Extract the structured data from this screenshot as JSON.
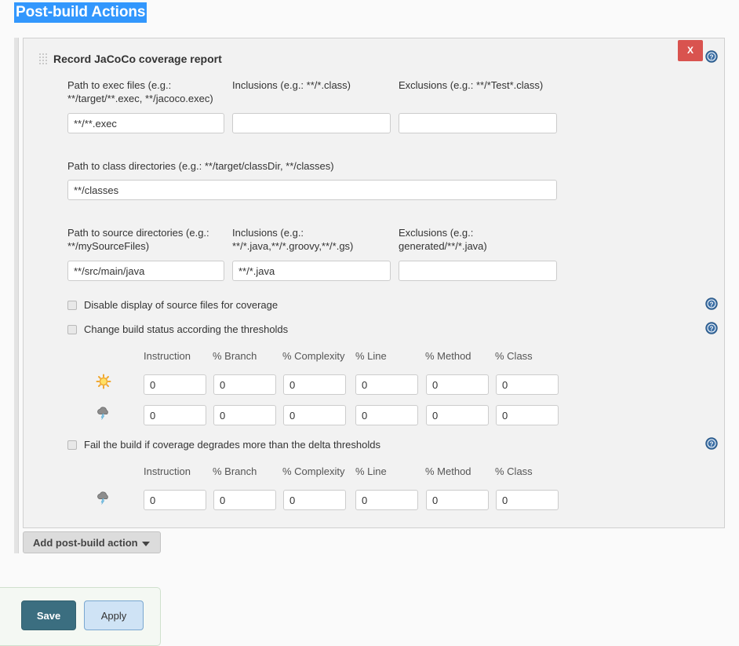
{
  "page": {
    "title": "Post-build Actions",
    "title_highlight_color": "#3297fd"
  },
  "panel": {
    "heading": "Record JaCoCo coverage report",
    "grip_icon": "drag-grip-icon",
    "delete_label": "X",
    "delete_color": "#d9534f",
    "help_icon": "help-icon"
  },
  "exec_section": {
    "path_label": "Path to exec files (e.g.: **/target/**.exec, **/jacoco.exec)",
    "path_value": "**/**.exec",
    "inclusions_label": "Inclusions (e.g.: **/*.class)",
    "inclusions_value": "",
    "exclusions_label": "Exclusions (e.g.: **/*Test*.class)",
    "exclusions_value": ""
  },
  "class_section": {
    "label": "Path to class directories (e.g.: **/target/classDir, **/classes)",
    "value": "**/classes"
  },
  "source_section": {
    "path_label": "Path to source directories (e.g.: **/mySourceFiles)",
    "path_value": "**/src/main/java",
    "inclusions_label": "Inclusions (e.g.: **/*.java,**/*.groovy,**/*.gs)",
    "inclusions_value": "**/*.java",
    "exclusions_label": "Exclusions (e.g.: generated/**/*.java)",
    "exclusions_value": ""
  },
  "options": {
    "disable_source_display": {
      "label": "Disable display of source files for coverage",
      "checked": false
    },
    "change_build_status": {
      "label": "Change build status according the thresholds",
      "checked": false
    },
    "fail_on_delta": {
      "label": "Fail the build if coverage degrades more than the delta thresholds",
      "checked": false
    }
  },
  "thresholds": {
    "columns": [
      "Instruction",
      "% Branch",
      "% Complexity",
      "% Line",
      "% Method",
      "% Class"
    ],
    "rows": [
      {
        "icon": "sun-icon",
        "icon_title": "Healthy (sunny)",
        "values": [
          "0",
          "0",
          "0",
          "0",
          "0",
          "0"
        ]
      },
      {
        "icon": "storm-cloud-icon",
        "icon_title": "Unhealthy (storm)",
        "values": [
          "0",
          "0",
          "0",
          "0",
          "0",
          "0"
        ]
      }
    ]
  },
  "delta_thresholds": {
    "columns": [
      "Instruction",
      "% Branch",
      "% Complexity",
      "% Line",
      "% Method",
      "% Class"
    ],
    "rows": [
      {
        "icon": "storm-cloud-icon",
        "icon_title": "Failure (storm)",
        "values": [
          "0",
          "0",
          "0",
          "0",
          "0",
          "0"
        ]
      }
    ]
  },
  "footer": {
    "add_action_label": "Add post-build action",
    "add_action_caret": "chevron-down-icon",
    "save_label": "Save",
    "apply_label": "Apply"
  }
}
